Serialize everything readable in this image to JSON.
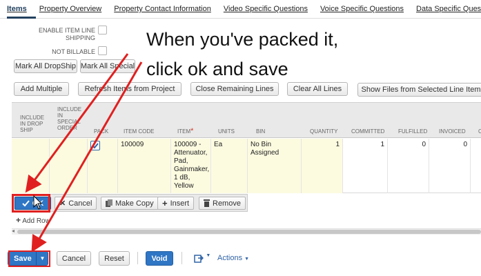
{
  "tabs": [
    {
      "label": "Items",
      "active": true
    },
    {
      "label": "Property Overview"
    },
    {
      "label": "Property Contact Information"
    },
    {
      "label": "Video Specific Questions"
    },
    {
      "label": "Voice Specific Questions"
    },
    {
      "label": "Data Specific Question"
    }
  ],
  "options": {
    "enable_item_line_1": "ENABLE ITEM LINE",
    "enable_item_line_2": "SHIPPING",
    "not_billable": "NOT BILLABLE"
  },
  "buttons": {
    "mark_all_dropship": "Mark All DropShip",
    "mark_all_special": "Mark All Special",
    "add_multiple": "Add Multiple",
    "refresh_items": "Refresh Items from Project",
    "close_remaining": "Close Remaining Lines",
    "clear_all": "Clear All Lines",
    "show_files": "Show Files from Selected Line Item"
  },
  "annotation": {
    "line1": "When you've packed it,",
    "line2": "click ok and save"
  },
  "grid": {
    "headers": {
      "include_drop_ship": [
        "INCLUDE",
        "IN DROP",
        "SHIP"
      ],
      "include_special": [
        "INCLUDE",
        "IN",
        "SPECIAL",
        "ORDER"
      ],
      "pack": "PACK",
      "item_code": "ITEM CODE",
      "item": "ITEM",
      "item_required": "*",
      "units": "UNITS",
      "bin": "BIN",
      "quantity": "QUANTITY",
      "committed": "COMMITTED",
      "fulfilled": "FULFILLED",
      "invoiced": "INVOICED",
      "extra": "C"
    },
    "row": {
      "item_code": "100009",
      "item_lines": [
        "100009 -",
        "Attenuator,",
        "Pad,",
        "Gainmaker,",
        "1 dB,",
        "Yellow"
      ],
      "units": "Ea",
      "bin_lines": [
        "No Bin",
        "Assigned"
      ],
      "quantity": "1",
      "committed": "1",
      "fulfilled": "0",
      "invoiced": "0",
      "pack_checked": true
    }
  },
  "row_actions": {
    "ok": "OK",
    "cancel": "Cancel",
    "make_copy": "Make Copy",
    "insert": "Insert",
    "remove": "Remove"
  },
  "add_row": "Add Row",
  "footer": {
    "save": "Save",
    "cancel": "Cancel",
    "reset": "Reset",
    "void": "Void",
    "actions": "Actions"
  },
  "colors": {
    "primary_button": "#2f76c5",
    "annotation_red": "#e02020",
    "editable_cell": "#fcfbe0"
  }
}
